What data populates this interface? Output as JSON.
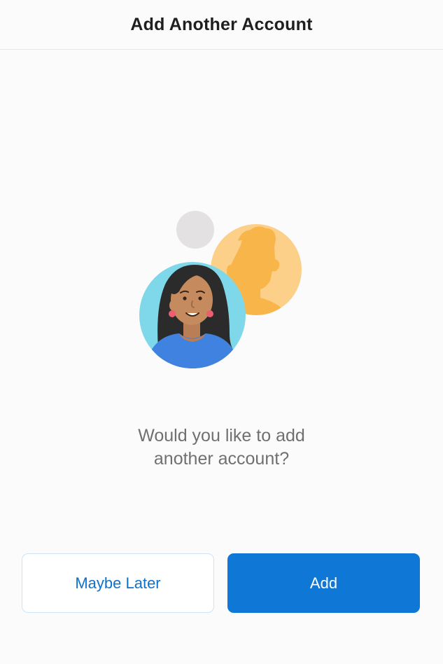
{
  "header": {
    "title": "Add Another Account"
  },
  "illustration": {
    "icon": "accounts-illustration-icon"
  },
  "prompt": {
    "line1": "Would you like to add",
    "line2": "another account?"
  },
  "actions": {
    "later_label": "Maybe Later",
    "add_label": "Add"
  },
  "colors": {
    "accent": "#0f78d6",
    "secondary_text": "#0f72c9",
    "person_bg": "#7fd8ea",
    "silhouette_bg": "#fdd08a",
    "silhouette": "#f8b64a",
    "small_circle": "#e3e1e1"
  }
}
